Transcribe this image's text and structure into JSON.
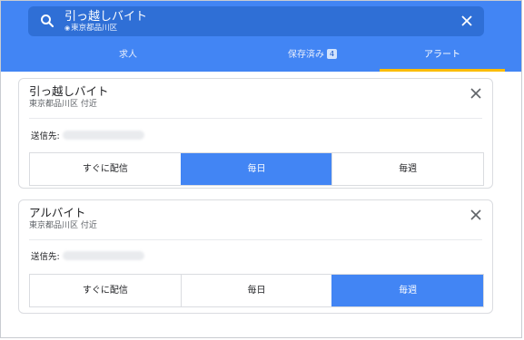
{
  "search": {
    "query": "引っ越しバイト",
    "location": "東京都品川区"
  },
  "tabs": [
    {
      "label": "求人"
    },
    {
      "label": "保存済み",
      "badge": "4"
    },
    {
      "label": "アラート",
      "selected": true
    }
  ],
  "alerts": [
    {
      "title": "引っ越しバイト",
      "location": "東京都品川区 付近",
      "send_to_label": "送信先:",
      "frequency_options": [
        "すぐに配信",
        "毎日",
        "毎週"
      ],
      "selected_frequency": "毎日"
    },
    {
      "title": "アルバイト",
      "location": "東京都品川区 付近",
      "send_to_label": "送信先:",
      "frequency_options": [
        "すぐに配信",
        "毎日",
        "毎週"
      ],
      "selected_frequency": "毎週"
    }
  ],
  "colors": {
    "header": "#4285f4",
    "search_bar": "#2f6fd6",
    "tab_indicator": "#fbbc04",
    "active_segment": "#4285f4"
  }
}
